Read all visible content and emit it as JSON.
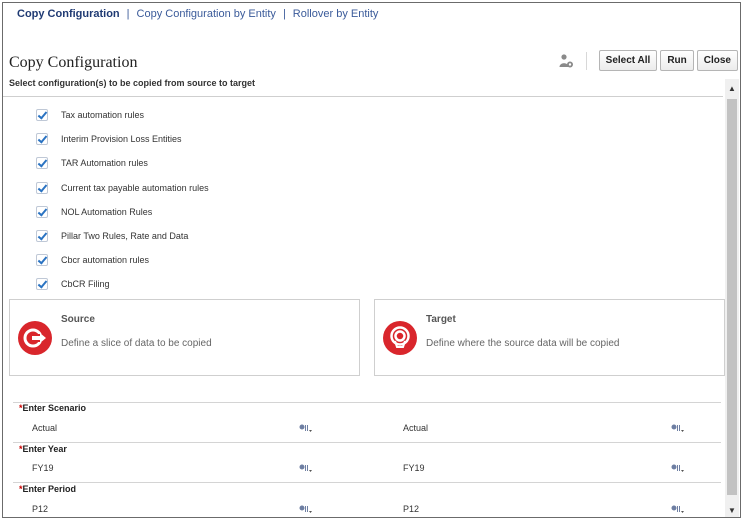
{
  "nav": {
    "items": [
      {
        "label": "Copy Configuration",
        "active": true
      },
      {
        "label": "Copy Configuration by Entity",
        "active": false
      },
      {
        "label": "Rollover by Entity",
        "active": false
      }
    ],
    "separator": "|"
  },
  "header": {
    "title": "Copy Configuration",
    "subtitle": "Select configuration(s) to be copied from source to target"
  },
  "toolbar": {
    "select_all_label": "Select All",
    "run_label": "Run",
    "close_label": "Close"
  },
  "checklist": {
    "items": [
      {
        "label": "Tax automation rules",
        "checked": true
      },
      {
        "label": "Interim Provision Loss Entities",
        "checked": true
      },
      {
        "label": "TAR Automation rules",
        "checked": true
      },
      {
        "label": "Current tax payable automation rules",
        "checked": true
      },
      {
        "label": "NOL Automation Rules",
        "checked": true
      },
      {
        "label": "Pillar Two Rules, Rate and Data",
        "checked": true
      },
      {
        "label": "Cbcr automation rules",
        "checked": true
      },
      {
        "label": "CbCR Filing",
        "checked": true
      }
    ]
  },
  "source_card": {
    "title": "Source",
    "description": "Define a slice of data to be copied"
  },
  "target_card": {
    "title": "Target",
    "description": "Define where the source data will be copied"
  },
  "fields": [
    {
      "required_mark": "*",
      "label": "Enter Scenario",
      "source_value": "Actual",
      "target_value": "Actual"
    },
    {
      "required_mark": "*",
      "label": "Enter Year",
      "source_value": "FY19",
      "target_value": "FY19"
    },
    {
      "required_mark": "*",
      "label": "Enter Period",
      "source_value": "P12",
      "target_value": "P12"
    }
  ],
  "colors": {
    "accent_red": "#d9262c",
    "link_blue": "#3b5b9a",
    "check_blue": "#2a73c2"
  },
  "icons": {
    "member_picker": "member-selector-icon",
    "person": "user-icon",
    "source": "source-exit-icon",
    "target": "target-icon"
  }
}
